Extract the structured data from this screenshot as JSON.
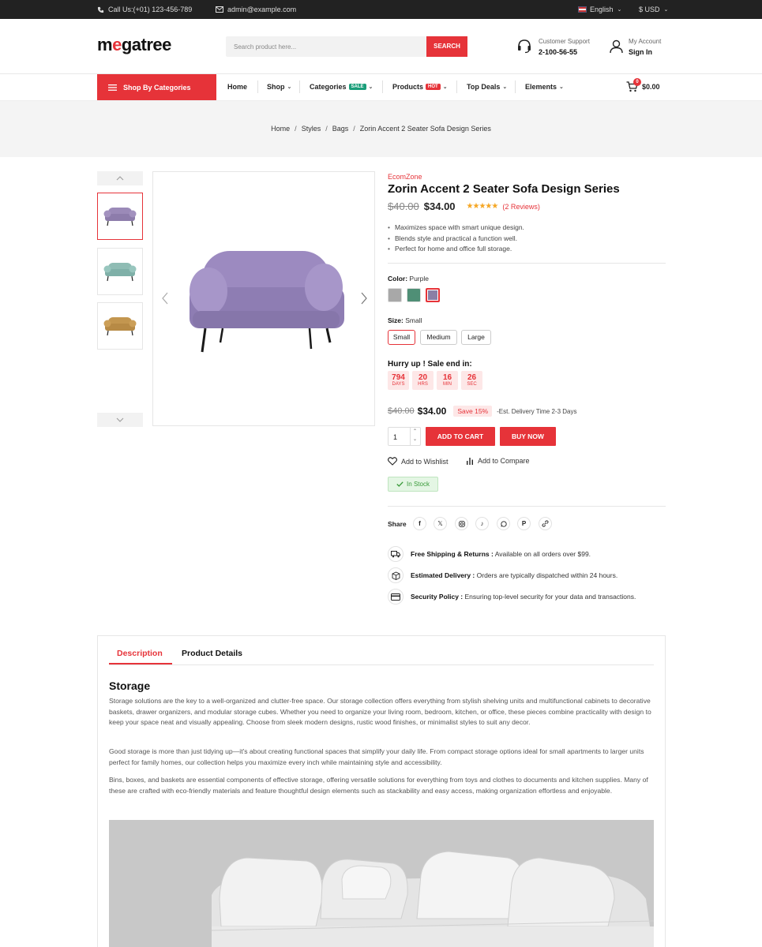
{
  "topbar": {
    "phone": "Call Us:(+01) 123-456-789",
    "email": "admin@example.com",
    "language": "English",
    "currency": "$ USD"
  },
  "header": {
    "logo_part1": "m",
    "logo_accent": "e",
    "logo_part2": "gatree",
    "search_placeholder": "Search product here...",
    "search_button": "SEARCH",
    "support_label": "Customer Support",
    "support_phone": "2-100-56-55",
    "account_label": "My Account",
    "account_action": "Sign In"
  },
  "nav": {
    "categories_button": "Shop By Categories",
    "items": [
      {
        "label": "Home"
      },
      {
        "label": "Shop"
      },
      {
        "label": "Categories",
        "tag": "SALE",
        "tag_color": "#1a9e7a"
      },
      {
        "label": "Products",
        "tag": "HOT",
        "tag_color": "#e63339"
      },
      {
        "label": "Top Deals"
      },
      {
        "label": "Elements"
      }
    ],
    "cart_count": "0",
    "cart_total": "$0.00"
  },
  "breadcrumb": [
    "Home",
    "Styles",
    "Bags",
    "Zorin Accent 2 Seater Sofa Design Series"
  ],
  "product": {
    "brand": "EcomZone",
    "title": "Zorin Accent 2 Seater Sofa Design Series",
    "old_price": "$40.00",
    "price": "$34.00",
    "rating": 5,
    "stars": "★★★★★",
    "reviews": "(2 Reviews)",
    "bullets": [
      "Maximizes space with smart unique design.",
      "Blends style and practical a function well.",
      "Perfect for home and office full storage."
    ],
    "color_label": "Color:",
    "color_value": "Purple",
    "colors": [
      "#a8a8a8",
      "#4f8f76",
      "#8a7fa6"
    ],
    "size_label": "Size:",
    "size_value": "Small",
    "sizes": [
      "Small",
      "Medium",
      "Large"
    ],
    "hurry_label": "Hurry up ! Sale end in:",
    "countdown": [
      {
        "value": "794",
        "unit": "DAYS"
      },
      {
        "value": "20",
        "unit": "HRS"
      },
      {
        "value": "16",
        "unit": "MIN"
      },
      {
        "value": "26",
        "unit": "SEC"
      }
    ],
    "save_badge": "Save 15%",
    "delivery_note": "-Est. Delivery Time 2-3 Days",
    "quantity": "1",
    "add_to_cart": "ADD TO CART",
    "buy_now": "BUY NOW",
    "wishlist": "Add to Wishlist",
    "compare": "Add to Compare",
    "stock": "In Stock",
    "share_label": "Share",
    "social_icons": [
      "facebook-icon",
      "x-icon",
      "instagram-icon",
      "tiktok-icon",
      "whatsapp-icon",
      "pinterest-icon",
      "link-icon"
    ],
    "features": [
      {
        "title": "Free Shipping & Returns :",
        "text": "Available on all orders over $99."
      },
      {
        "title": "Estimated Delivery :",
        "text": "Orders are typically dispatched within 24 hours."
      },
      {
        "title": "Security Policy :",
        "text": "Ensuring top-level security for your data and transactions."
      }
    ]
  },
  "tabs": {
    "items": [
      "Description",
      "Product Details"
    ],
    "heading": "Storage",
    "paragraphs": [
      "Storage solutions are the key to a well-organized and clutter-free space. Our storage collection offers everything from stylish shelving units and multifunctional cabinets to decorative baskets, drawer organizers, and modular storage cubes. Whether you need to organize your living room, bedroom, kitchen, or office, these pieces combine practicality with design to keep your space neat and visually appealing. Choose from sleek modern designs, rustic wood finishes, or minimalist styles to suit any decor.",
      "Good storage is more than just tidying up—it's about creating functional spaces that simplify your daily life. From compact storage options ideal for small apartments to larger units perfect for family homes, our collection helps you maximize every inch while maintaining style and accessibility.",
      "Bins, boxes, and baskets are essential components of effective storage, offering versatile solutions for everything from toys and clothes to documents and kitchen supplies. Many of these are crafted with eco-friendly materials and feature thoughtful design elements such as stackability and easy access, making organization effortless and enjoyable."
    ]
  },
  "colors": {
    "accent": "#e63339",
    "topbar": "#222222",
    "stock_green": "#3a9a3a"
  }
}
